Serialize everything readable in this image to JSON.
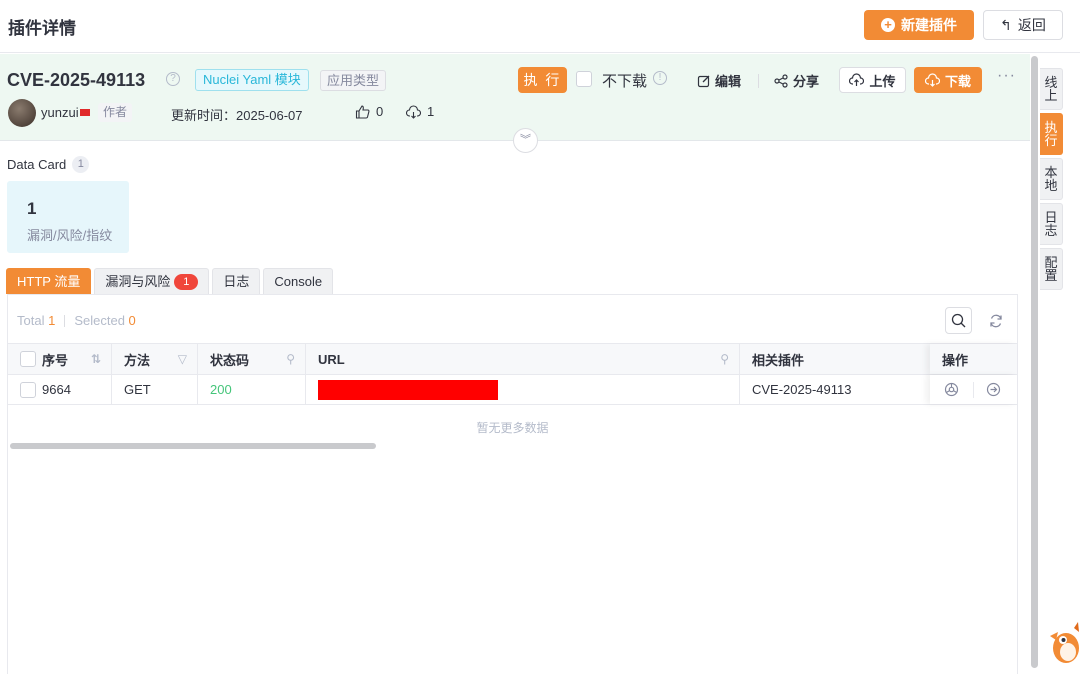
{
  "page": {
    "title": "插件详情"
  },
  "topbar": {
    "new_plugin_label": "新建插件",
    "back_label": "返回"
  },
  "plugin": {
    "name": "CVE-2025-49113",
    "type_tag": "Nuclei Yaml 模块",
    "app_tag": "应用类型",
    "author": "yunzui",
    "author_tag": "作者",
    "update_time": "更新时间：2025-06-07",
    "likes": "0",
    "downloads": "1"
  },
  "actions": {
    "exec_label": "执 行",
    "no_download_label": "不下载",
    "edit_label": "编辑",
    "share_label": "分享",
    "upload_label": "上传",
    "download_label": "下载",
    "more_icon": "more-icon"
  },
  "data_card": {
    "title": "Data Card",
    "count": "1",
    "value": "1",
    "label": "漏洞/风险/指纹"
  },
  "tabs": [
    {
      "label": "HTTP 流量",
      "active": true
    },
    {
      "label": "漏洞与风险",
      "badge": "1"
    },
    {
      "label": "日志"
    },
    {
      "label": "Console"
    }
  ],
  "table": {
    "total_label": "Total",
    "total_value": "1",
    "selected_label": "Selected",
    "selected_value": "0",
    "columns": [
      "序号",
      "方法",
      "状态码",
      "URL",
      "相关插件",
      "操作"
    ],
    "rows": [
      {
        "id": "9664",
        "method": "GET",
        "status": "200",
        "url": "",
        "plugin": "CVE-2025-49113"
      }
    ],
    "empty_text": "暂无更多数据"
  },
  "side_tabs": [
    "线上",
    "执行",
    "本地",
    "日志",
    "配置"
  ],
  "colors": {
    "accent": "#f28b35",
    "success": "#45c57a",
    "danger": "#f0463b",
    "redact": "#ff0000"
  }
}
